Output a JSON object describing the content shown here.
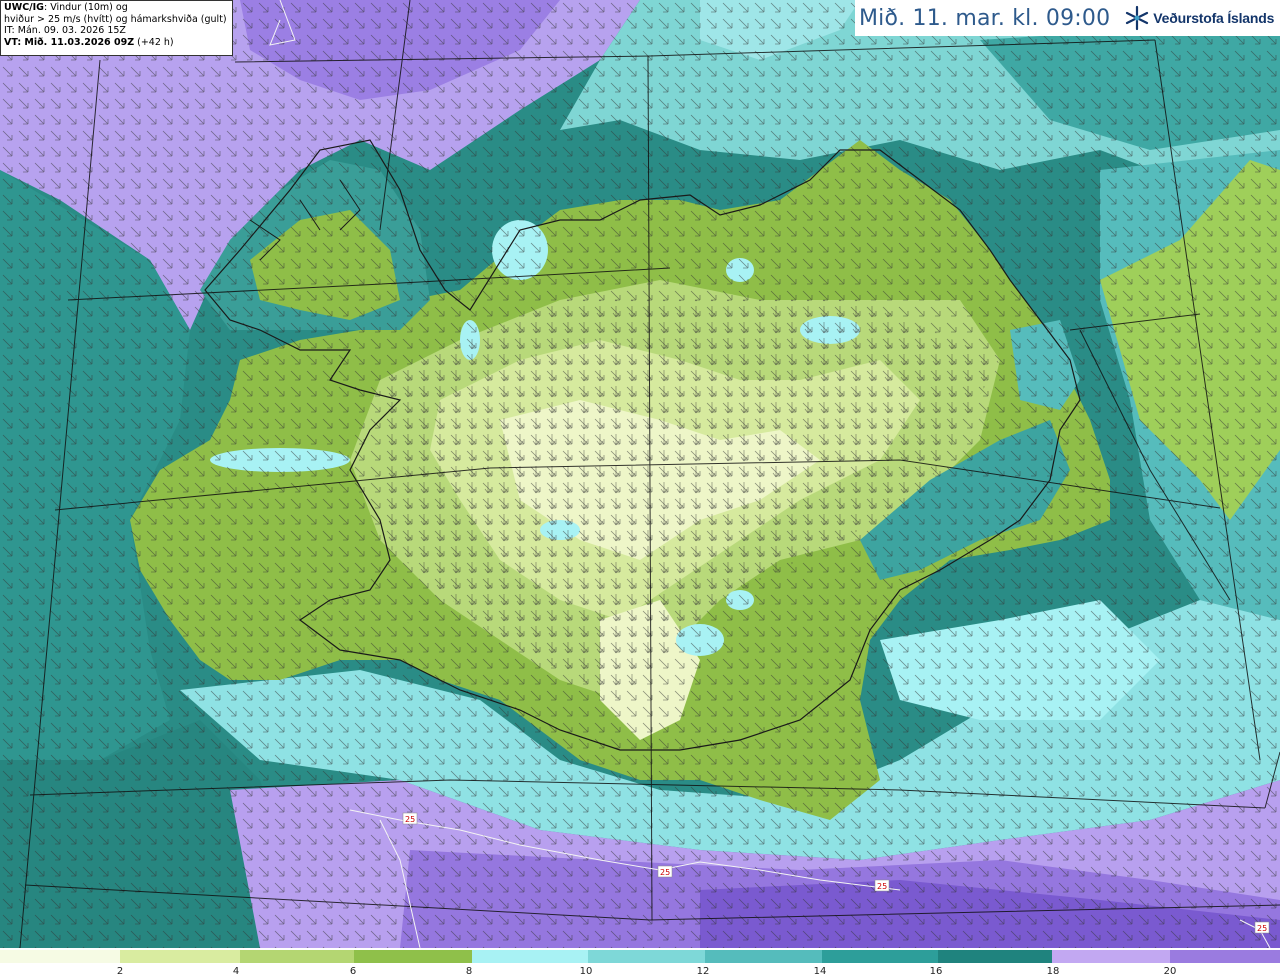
{
  "info": {
    "model_prefix": "UWC/IG",
    "line1_rest": ": Vindur (10m) og",
    "line2": "hviður > 25 m/s (hvítt) og hámarkshviða (gult)",
    "line3": "IT: Mán. 09. 03. 2026 15Z",
    "vt_prefix": "VT: Mið. 11.03.2026 09Z",
    "vt_rest": " (+42 h)"
  },
  "title": "Mið. 11. mar. kl. 09:00",
  "logo": {
    "text": "Veðurstofa Íslands",
    "icon": "snowflake-icon"
  },
  "contour_labels": [
    "25",
    "25",
    "25",
    "25"
  ],
  "colors": {
    "scale": [
      "#f6fbe4",
      "#d9eca0",
      "#b4d672",
      "#8fc04a",
      "#a8f2f4",
      "#7ed8d8",
      "#55bcbc",
      "#2d9e9a",
      "#1f837e",
      "#c2a8f2",
      "#9a7be0",
      "#7050c8"
    ]
  },
  "colorbar": {
    "ticks": [
      "2",
      "4",
      "6",
      "8",
      "10",
      "12",
      "14",
      "16",
      "18",
      "20"
    ]
  }
}
